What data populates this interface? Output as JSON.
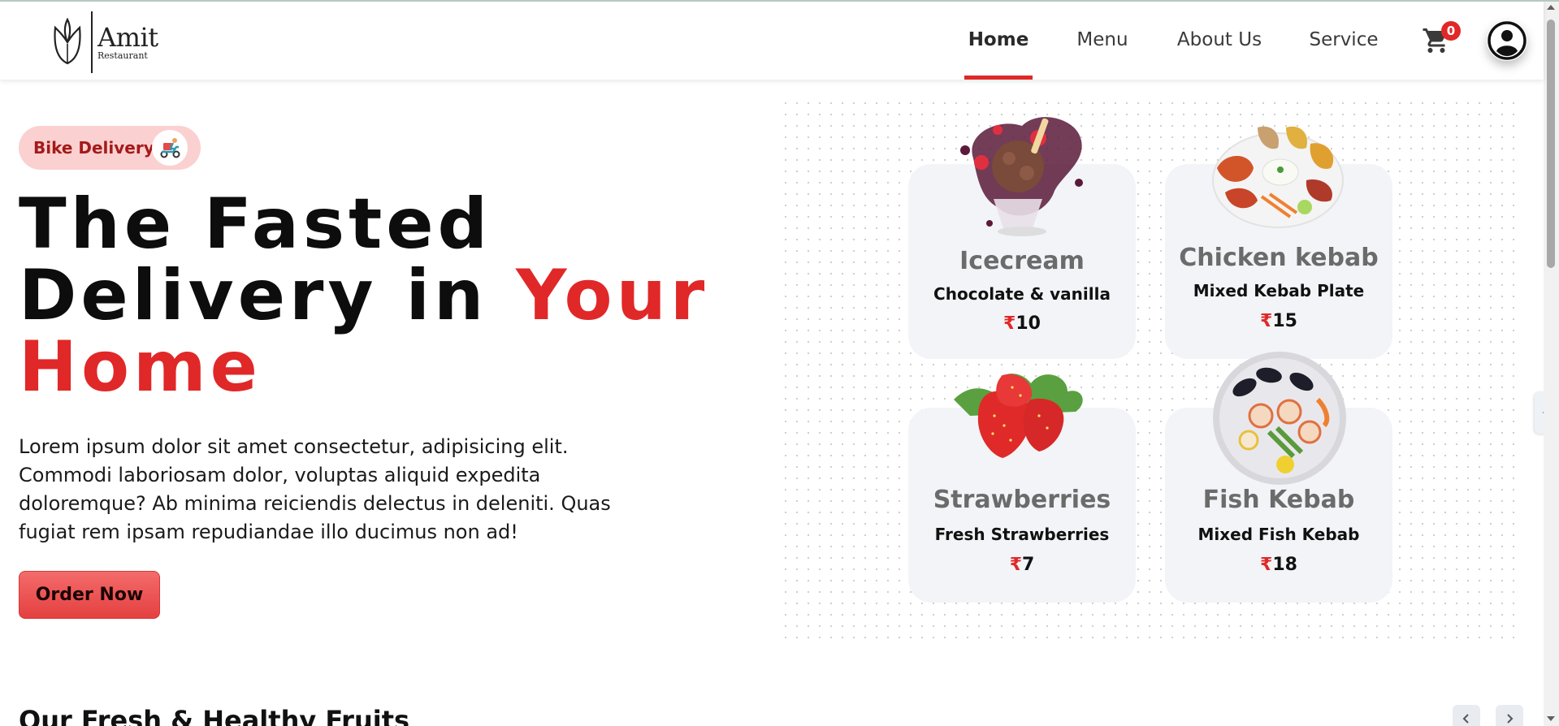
{
  "header": {
    "logo": {
      "name": "Amit",
      "sub": "Restaurant",
      "icon": "tulip-logo-icon"
    },
    "nav": [
      {
        "label": "Home",
        "active": true
      },
      {
        "label": "Menu",
        "active": false
      },
      {
        "label": "About Us",
        "active": false
      },
      {
        "label": "Service",
        "active": false
      }
    ],
    "cart": {
      "icon": "cart-icon",
      "count": "0"
    },
    "profile_icon": "user-circle-icon"
  },
  "hero": {
    "badge": {
      "label": "Bike Delivery",
      "icon": "scooter-delivery-icon"
    },
    "title": {
      "line1": "The Fasted",
      "line2_start": "Delivery in ",
      "line2_highlight": "Your",
      "line3_highlight": "Home"
    },
    "description": "Lorem ipsum dolor sit amet consectetur, adipisicing elit. Commodi laboriosam dolor, voluptas aliquid expedita doloremque? Ab minima reiciendis delectus in deleniti. Quas fugiat rem ipsam repudiandae illo ducimus non ad!",
    "cta": "Order Now"
  },
  "cards": [
    {
      "name": "Icecream",
      "sub": "Chocolate & vanilla",
      "currency": "₹",
      "price": "10",
      "image": "icecream-image"
    },
    {
      "name": "Chicken kebab",
      "sub": "Mixed Kebab Plate",
      "currency": "₹",
      "price": "15",
      "image": "kebab-plate-image"
    },
    {
      "name": "Strawberries",
      "sub": "Fresh Strawberries",
      "currency": "₹",
      "price": "7",
      "image": "strawberries-image"
    },
    {
      "name": "Fish Kebab",
      "sub": "Mixed Fish Kebab",
      "currency": "₹",
      "price": "18",
      "image": "fish-kebab-image"
    }
  ],
  "section": {
    "title": "Our Fresh & Healthy Fruits"
  },
  "colors": {
    "accent": "#e02828",
    "badge_bg": "#fbd0d0",
    "card_bg": "#f2f4f7"
  }
}
